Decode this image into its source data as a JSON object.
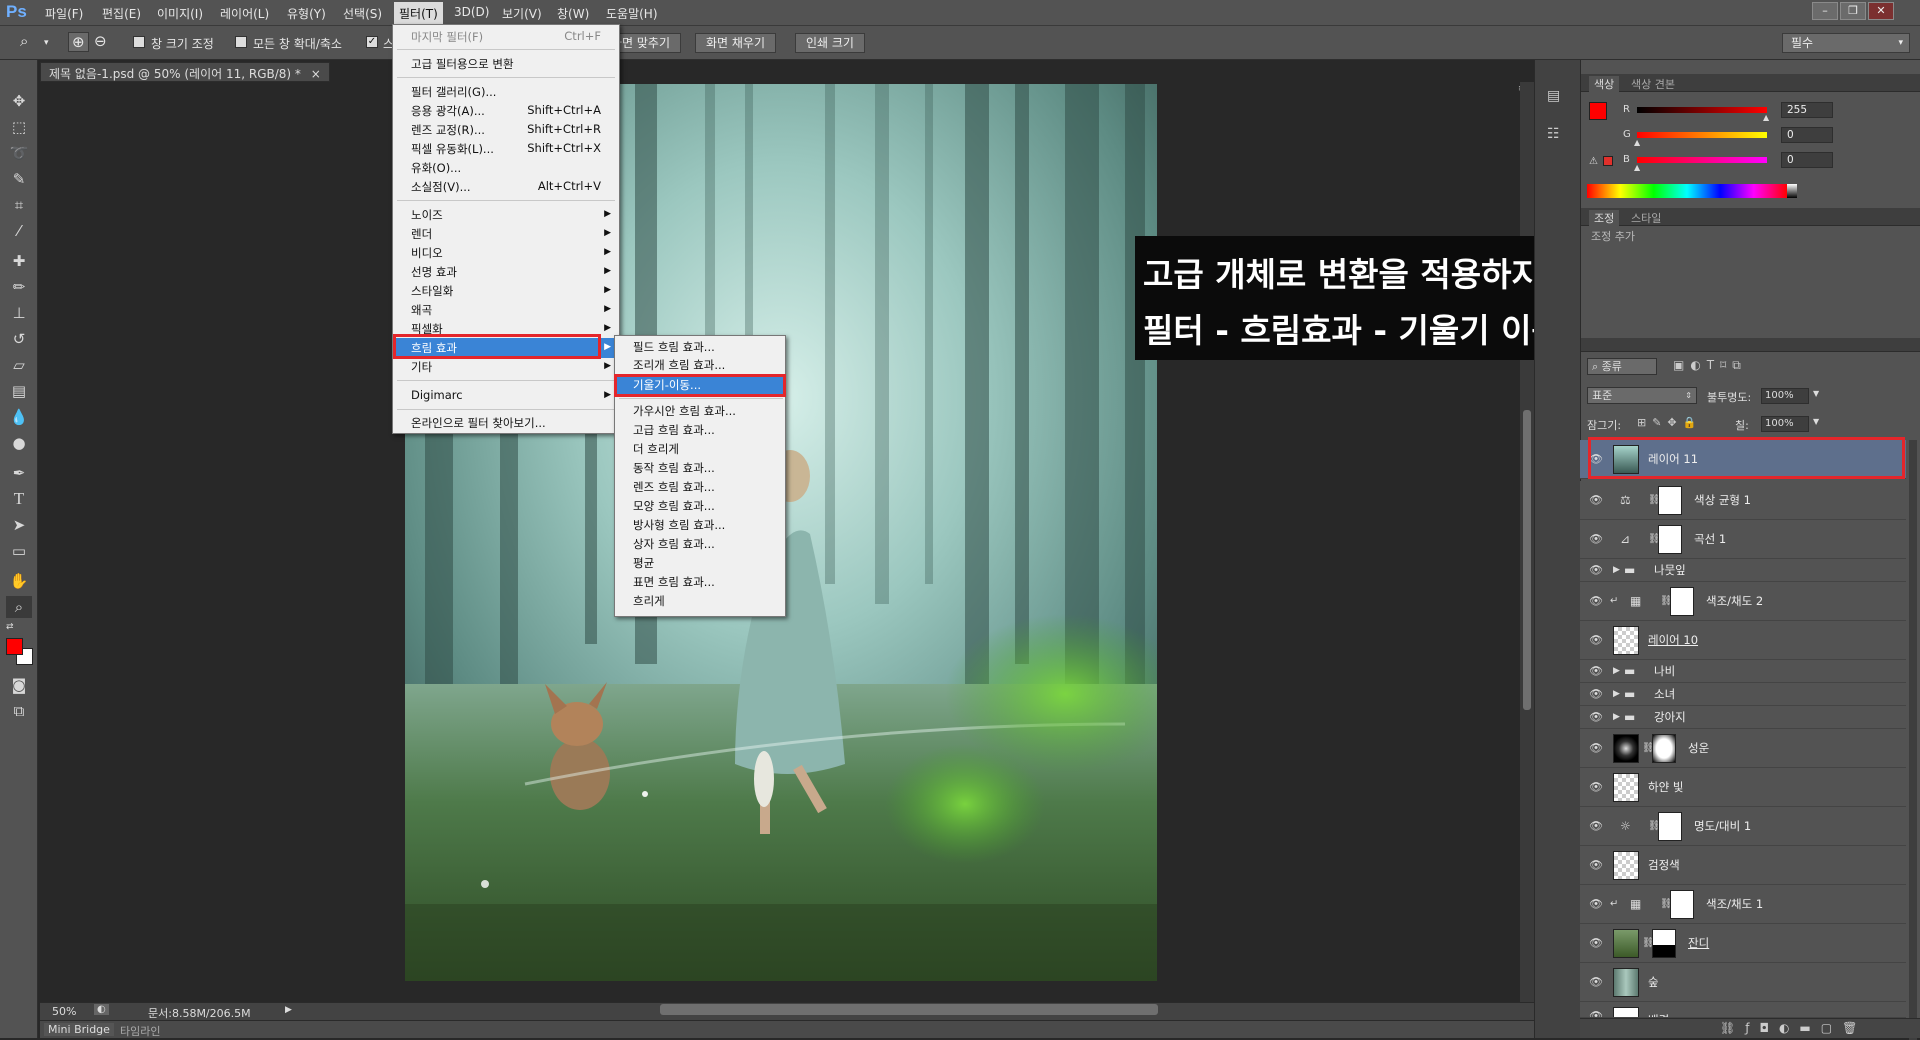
{
  "app": {
    "logo": "Ps"
  },
  "menubar": {
    "items": [
      "파일(F)",
      "편집(E)",
      "이미지(I)",
      "레이어(L)",
      "유형(Y)",
      "선택(S)",
      "필터(T)",
      "3D(D)",
      "보기(V)",
      "창(W)",
      "도움말(H)"
    ]
  },
  "options": {
    "resize_label": "창 크기 조정",
    "zoom_all_label": "모든 창 확대/축소",
    "scrubby_label": "스",
    "fit_screen": "화면 맞추기",
    "fill_screen": "화면 채우기",
    "print_size": "인쇄 크기",
    "workspace": "필수"
  },
  "document": {
    "tab_title": "제목 없음-1.psd @ 50% (레이어 11, RGB/8) *",
    "zoom": "50%",
    "doc_info": "문서:8.58M/206.5M"
  },
  "bottom_tabs": [
    "Mini Bridge",
    "타임라인"
  ],
  "filter_menu": {
    "top": [
      {
        "label": "마지막 필터(F)",
        "shortcut": "Ctrl+F"
      },
      {
        "label": "고급 필터용으로 변환",
        "shortcut": ""
      }
    ],
    "group2": [
      {
        "label": "필터 갤러리(G)...",
        "shortcut": ""
      },
      {
        "label": "응용 광각(A)...",
        "shortcut": "Shift+Ctrl+A"
      },
      {
        "label": "렌즈 교정(R)...",
        "shortcut": "Shift+Ctrl+R"
      },
      {
        "label": "픽셀 유동화(L)...",
        "shortcut": "Shift+Ctrl+X"
      },
      {
        "label": "유화(O)...",
        "shortcut": ""
      },
      {
        "label": "소실점(V)...",
        "shortcut": "Alt+Ctrl+V"
      }
    ],
    "group3": [
      "노이즈",
      "렌더",
      "비디오",
      "선명 효과",
      "스타일화",
      "왜곡",
      "픽셀화",
      "흐림 효과",
      "기타"
    ],
    "group4": [
      "Digimarc"
    ],
    "group5": [
      "온라인으로 필터 찾아보기..."
    ]
  },
  "blur_submenu": {
    "items": [
      "필드 흐림 효과...",
      "조리개 흐림 효과...",
      "기울기-이동...",
      "가우시안 흐림 효과...",
      "고급 흐림 효과...",
      "더 흐리게",
      "동작 흐림 효과...",
      "렌즈 흐림 효과...",
      "모양 흐림 효과...",
      "방사형 흐림 효과...",
      "상자 흐림 효과...",
      "평균",
      "표면 흐림 효과...",
      "흐리게"
    ],
    "selected": "기울기-이동..."
  },
  "annotation": {
    "line1": "고급 개체로 변환을 적용하지 않고",
    "line2": "필터 - 흐림효과 - 기울기 이동을 적용합니다."
  },
  "color_panel": {
    "tabs": [
      "색상",
      "색상 견본"
    ],
    "r_label": "R",
    "g_label": "G",
    "b_label": "B",
    "r": "255",
    "g": "0",
    "b": "0",
    "foreground": "#ff0000",
    "background": "#ffffff"
  },
  "adjust_panel": {
    "tabs": [
      "조정",
      "스타일"
    ],
    "hint": "조정 추가"
  },
  "layers_panel": {
    "filter_kind": "종류",
    "blend_mode": "표준",
    "opacity_label": "불투명도:",
    "opacity": "100%",
    "lock_label": "잠그기:",
    "fill_label": "칠:",
    "fill": "100%",
    "layers": [
      {
        "name": "레이어 11",
        "kind": "pixel",
        "selected": true
      },
      {
        "name": "색상 균형 1",
        "kind": "adjust",
        "icon": "balance"
      },
      {
        "name": "곡선 1",
        "kind": "adjust",
        "icon": "curves"
      },
      {
        "name": "나뭇잎",
        "kind": "group"
      },
      {
        "name": "색조/채도 2",
        "kind": "adjust",
        "icon": "huesat"
      },
      {
        "name": "레이어 10",
        "kind": "pixel"
      },
      {
        "name": "나비",
        "kind": "group"
      },
      {
        "name": "소녀",
        "kind": "group"
      },
      {
        "name": "강아지",
        "kind": "group"
      },
      {
        "name": "성운",
        "kind": "pixelmask"
      },
      {
        "name": "하얀 빛",
        "kind": "pixel"
      },
      {
        "name": "명도/대비 1",
        "kind": "adjust",
        "icon": "brightness"
      },
      {
        "name": "검정색",
        "kind": "pixel"
      },
      {
        "name": "색조/채도 1",
        "kind": "adjust",
        "icon": "huesat"
      },
      {
        "name": "잔디",
        "kind": "pixelmask"
      },
      {
        "name": "숲",
        "kind": "pixel"
      },
      {
        "name": "배경",
        "kind": "pixel"
      }
    ]
  }
}
